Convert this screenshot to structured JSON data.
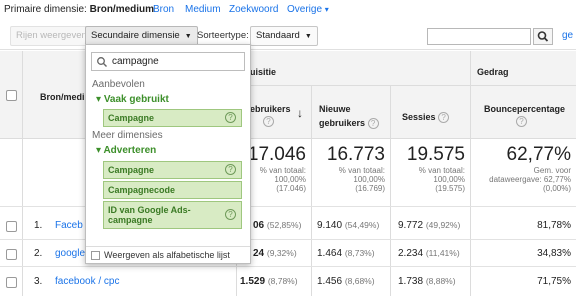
{
  "dimension_bar": {
    "primary_label": "Primaire dimensie:",
    "primary_value": "Bron/medium",
    "options": [
      "Bron",
      "Medium",
      "Zoekwoord",
      "Overige"
    ]
  },
  "toolbar": {
    "plot_rows": "Rijen weergeven",
    "secondary_dimension": "Secundaire dimensie",
    "sort_type_label": "Sorteertype:",
    "sort_type_value": "Standaard",
    "advanced": "ge"
  },
  "dropdown": {
    "search_value": "campagne",
    "group_recommended": "Aanbevolen",
    "sub_frequent": "Vaak gebruikt",
    "recommended_items": [
      "Campagne"
    ],
    "group_more": "Meer dimensies",
    "sub_advertisers": "Adverteren",
    "more_items": [
      "Campagne",
      "Campagnecode",
      "ID van Google Ads-campagne"
    ],
    "alphabetical": "Weergeven als alfabetische lijst"
  },
  "table": {
    "col_source_medium": "Bron/medium",
    "group_acquisition": "uisitie",
    "group_behavior": "Gedrag",
    "col_users": "ebruikers",
    "col_new_users": "Nieuwe",
    "col_new_users2": "gebruikers",
    "col_sessions": "Sessies",
    "col_bounce": "Bouncepercentage",
    "totals": {
      "users": "17.046",
      "users_sub": "% van totaal:\n100,00%\n(17.046)",
      "new_users": "16.773",
      "new_users_sub": "% van totaal:\n100,00%\n(16.769)",
      "sessions": "19.575",
      "sessions_sub": "% van totaal:\n100,00%\n(19.575)",
      "bounce": "62,77%",
      "bounce_sub": "Gem. voor\ndataweergave: 62,77%\n(0,00%)"
    },
    "rows": [
      {
        "index": "1.",
        "source": "Faceb",
        "users": "06",
        "users_pct": "(52,85%)",
        "new_users": "9.140",
        "new_users_pct": "(54,49%)",
        "sessions": "9.772",
        "sessions_pct": "(49,92%)",
        "bounce": "81,78%"
      },
      {
        "index": "2.",
        "source": "google",
        "users": "24",
        "users_pct": "(9,32%)",
        "new_users": "1.464",
        "new_users_pct": "(8,73%)",
        "sessions": "2.234",
        "sessions_pct": "(11,41%)",
        "bounce": "34,83%"
      },
      {
        "index": "3.",
        "source": "facebook / cpc",
        "users": "1.529",
        "users_pct": "(8,78%)",
        "new_users": "1.456",
        "new_users_pct": "(8,68%)",
        "sessions": "1.738",
        "sessions_pct": "(8,88%)",
        "bounce": "71,75%"
      }
    ]
  }
}
